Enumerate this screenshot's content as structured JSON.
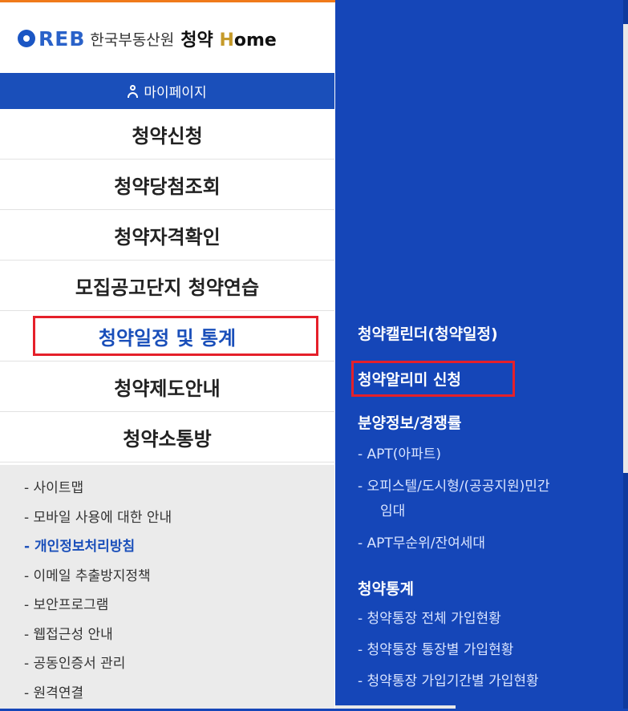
{
  "logo": {
    "reb": "REB",
    "org_name": "한국부동산원",
    "service_prefix": "청약",
    "service_h": "H",
    "service_rest": "ome"
  },
  "mypage": {
    "label": "마이페이지"
  },
  "menu": [
    {
      "label": "청약신청"
    },
    {
      "label": "청약당첨조회"
    },
    {
      "label": "청약자격확인"
    },
    {
      "label": "모집공고단지 청약연습"
    },
    {
      "label": "청약일정 및 통계"
    },
    {
      "label": "청약제도안내"
    },
    {
      "label": "청약소통방"
    }
  ],
  "footer_links": [
    "- 사이트맵",
    "- 모바일 사용에 대한 안내",
    "- 개인정보처리방침",
    "- 이메일 추출방지정책",
    "- 보안프로그램",
    "- 웹접근성 안내",
    "- 공동인증서 관리",
    "- 원격연결"
  ],
  "submenu": {
    "calendar": "청약캘린더(청약일정)",
    "alarm": "청약알리미 신청",
    "sale_info": "분양정보/경쟁률",
    "apt": "- APT(아파트)",
    "officetel": "- 오피스텔/도시형/(공공지원)민간",
    "officetel_cont": "임대",
    "apt_remain": "- APT무순위/잔여세대",
    "stats": "청약통계",
    "stats_total": "- 청약통장 전체 가입현황",
    "stats_type": "- 청약통장 통장별 가입현황",
    "stats_period": "- 청약통장 가입기간별 가입현황"
  },
  "colors": {
    "primary_blue": "#1a4fba",
    "panel_blue": "#1546b8",
    "highlight_red": "#e5202a",
    "top_accent": "#f07a1a"
  }
}
